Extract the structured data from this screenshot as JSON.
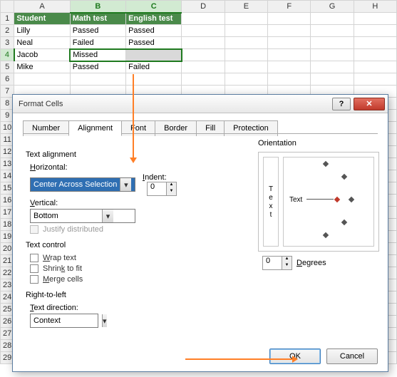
{
  "sheet": {
    "cols": [
      "",
      "A",
      "B",
      "C",
      "D",
      "E",
      "F",
      "G",
      "H"
    ],
    "rows": [
      {
        "n": "1",
        "A": "Student",
        "B": "Math test",
        "C": "English test"
      },
      {
        "n": "2",
        "A": "Lilly",
        "B": "Passed",
        "C": "Passed"
      },
      {
        "n": "3",
        "A": "Neal",
        "B": "Failed",
        "C": "Passed"
      },
      {
        "n": "4",
        "A": "Jacob",
        "B": "Missed",
        "C": ""
      },
      {
        "n": "5",
        "A": "Mike",
        "B": "Passed",
        "C": "Failed"
      }
    ],
    "extra_rows": [
      "6",
      "7",
      "8",
      "9",
      "10",
      "11",
      "12",
      "13",
      "14",
      "15",
      "16",
      "17",
      "18",
      "19",
      "20",
      "21",
      "22",
      "23",
      "24",
      "25",
      "26",
      "27",
      "28",
      "29"
    ]
  },
  "dialog": {
    "title": "Format Cells",
    "tabs": [
      "Number",
      "Alignment",
      "Font",
      "Border",
      "Fill",
      "Protection"
    ],
    "groups": {
      "text_alignment": "Text alignment",
      "text_control": "Text control",
      "rtl": "Right-to-left",
      "orientation": "Orientation"
    },
    "labels": {
      "horizontal": "Horizontal:",
      "vertical": "Vertical:",
      "indent": "Indent:",
      "justify": "Justify distributed",
      "wrap": "Wrap text",
      "shrink": "Shrink to fit",
      "merge": "Merge cells",
      "text_dir": "Text direction:",
      "degrees": "Degrees",
      "textv": "Text",
      "texth": "Text"
    },
    "values": {
      "horizontal": "Center Across Selection",
      "vertical": "Bottom",
      "indent": "0",
      "text_dir": "Context",
      "degrees": "0"
    },
    "buttons": {
      "ok": "OK",
      "cancel": "Cancel",
      "help": "?",
      "close": "✕"
    }
  }
}
